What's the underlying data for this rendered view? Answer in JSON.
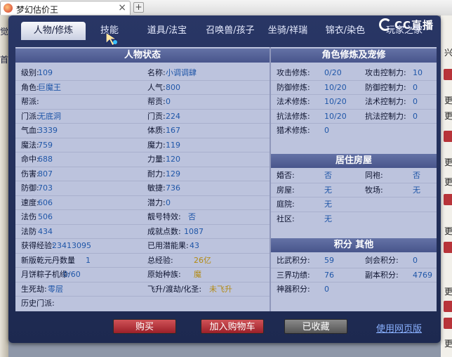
{
  "browser": {
    "tab_title": "梦幻估价王",
    "close_glyph": "×",
    "new_tab_glyph": "+"
  },
  "background": {
    "left_chars": [
      "觉",
      "首"
    ],
    "right_chars": [
      "兴",
      "更",
      "更",
      "更",
      "更",
      "更",
      "更",
      "更"
    ]
  },
  "nav": {
    "tabs": [
      "人物/修炼",
      "技能",
      "道具/法宝",
      "召唤兽/孩子",
      "坐骑/祥瑞",
      "锦衣/染色",
      "玩家之家"
    ],
    "active": "人物/修炼"
  },
  "logo": {
    "text": "CC直播"
  },
  "status": {
    "title": "人物状态",
    "fields": [
      [
        "级别:",
        "109"
      ],
      [
        "名称:",
        "小调调肆"
      ],
      [
        "角色:",
        "巨魔王"
      ],
      [
        "人气:",
        "800"
      ],
      [
        "帮派:",
        ""
      ],
      [
        "帮贡:",
        "0"
      ],
      [
        "门派:",
        "无底洞"
      ],
      [
        "门贡:",
        "224"
      ],
      [
        "气血:",
        "3339"
      ],
      [
        "体质:",
        "167"
      ],
      [
        "魔法:",
        "759"
      ],
      [
        "魔力:",
        "119"
      ],
      [
        "命中:",
        "688"
      ],
      [
        "力量:",
        "120"
      ],
      [
        "伤害:",
        "807"
      ],
      [
        "耐力:",
        "129"
      ],
      [
        "防御:",
        "703"
      ],
      [
        "敏捷:",
        "736"
      ],
      [
        "速度:",
        "606"
      ],
      [
        "潜力:",
        "0"
      ],
      [
        "法伤",
        "506"
      ],
      [
        "靓号特效:",
        "否"
      ],
      [
        "法防",
        "434"
      ],
      [
        "成就点数:",
        "1087"
      ],
      [
        "获得经验:",
        "23413095"
      ],
      [
        "已用潜能果:",
        "43"
      ],
      [
        "新版乾元丹数量",
        "1"
      ],
      [
        "总经验:",
        "26亿"
      ],
      [
        "月饼粽子机缘:",
        "0/60"
      ],
      [
        "原始种族:",
        "魔"
      ],
      [
        "生死劫:",
        "零层"
      ],
      [
        "飞升/渡劫/化圣:",
        "未飞升"
      ],
      [
        "历史门派:",
        ""
      ],
      [
        "",
        ""
      ]
    ]
  },
  "cultivation": {
    "title": "角色修炼及宠修",
    "rows": [
      [
        "攻击修炼:",
        "0/20",
        "攻击控制力:",
        "10"
      ],
      [
        "防御修炼:",
        "10/20",
        "防御控制力:",
        "0"
      ],
      [
        "法术修炼:",
        "10/20",
        "法术控制力:",
        "0"
      ],
      [
        "抗法修炼:",
        "10/20",
        "抗法控制力:",
        "0"
      ],
      [
        "猎术修炼:",
        "0",
        "",
        ""
      ]
    ]
  },
  "housing": {
    "title": "居住房屋",
    "rows": [
      [
        "婚否:",
        "否",
        "同袍:",
        "否"
      ],
      [
        "房屋:",
        "无",
        "牧场:",
        "无"
      ],
      [
        "庭院:",
        "无",
        "",
        ""
      ],
      [
        "社区:",
        "无",
        "",
        ""
      ]
    ]
  },
  "points": {
    "title": "积分 其他",
    "rows": [
      [
        "比武积分:",
        "59",
        "剑会积分:",
        "0"
      ],
      [
        "三界功绩:",
        "76",
        "副本积分:",
        "4769"
      ],
      [
        "神器积分:",
        "0",
        "",
        ""
      ]
    ]
  },
  "buttons": {
    "buy": "购买",
    "add_cart": "加入购物车",
    "collected": "已收藏",
    "web_version": "使用网页版"
  }
}
